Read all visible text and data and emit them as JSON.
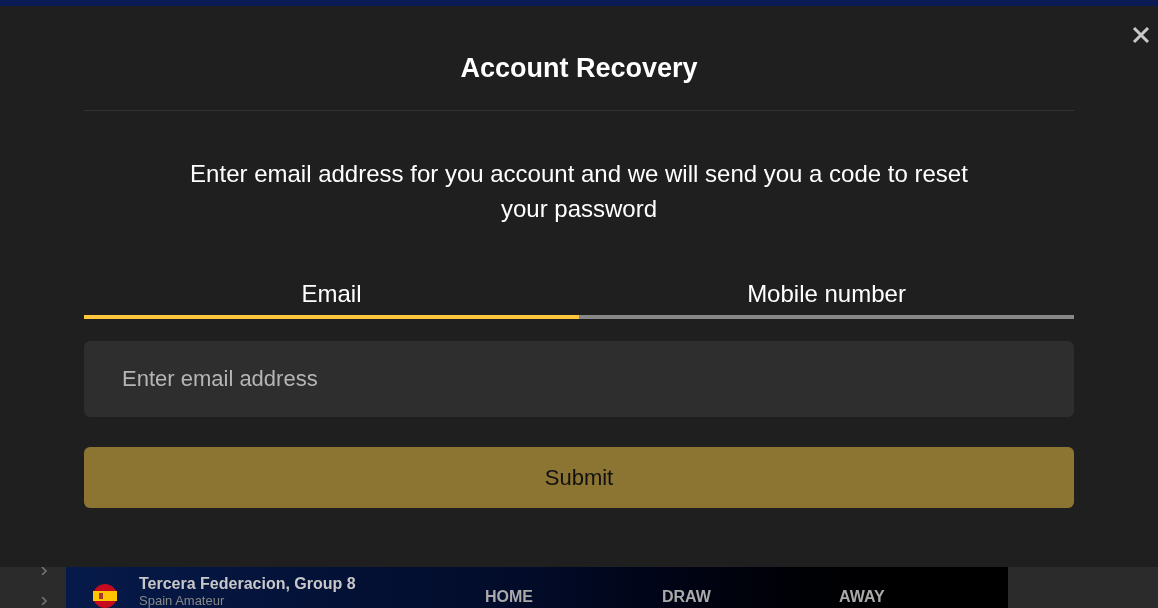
{
  "dialog": {
    "title": "Account Recovery",
    "description": "Enter email address for you account and we will send you a code to reset your password",
    "tabs": [
      {
        "label": "Email",
        "selected": true
      },
      {
        "label": "Mobile number",
        "selected": false
      }
    ],
    "field": {
      "placeholder": "Enter email address"
    },
    "submit": "Submit"
  },
  "background": {
    "league": "Tercera Federacion, Group 8",
    "country": "Spain Amateur",
    "columns": [
      "HOME",
      "DRAW",
      "AWAY"
    ]
  }
}
